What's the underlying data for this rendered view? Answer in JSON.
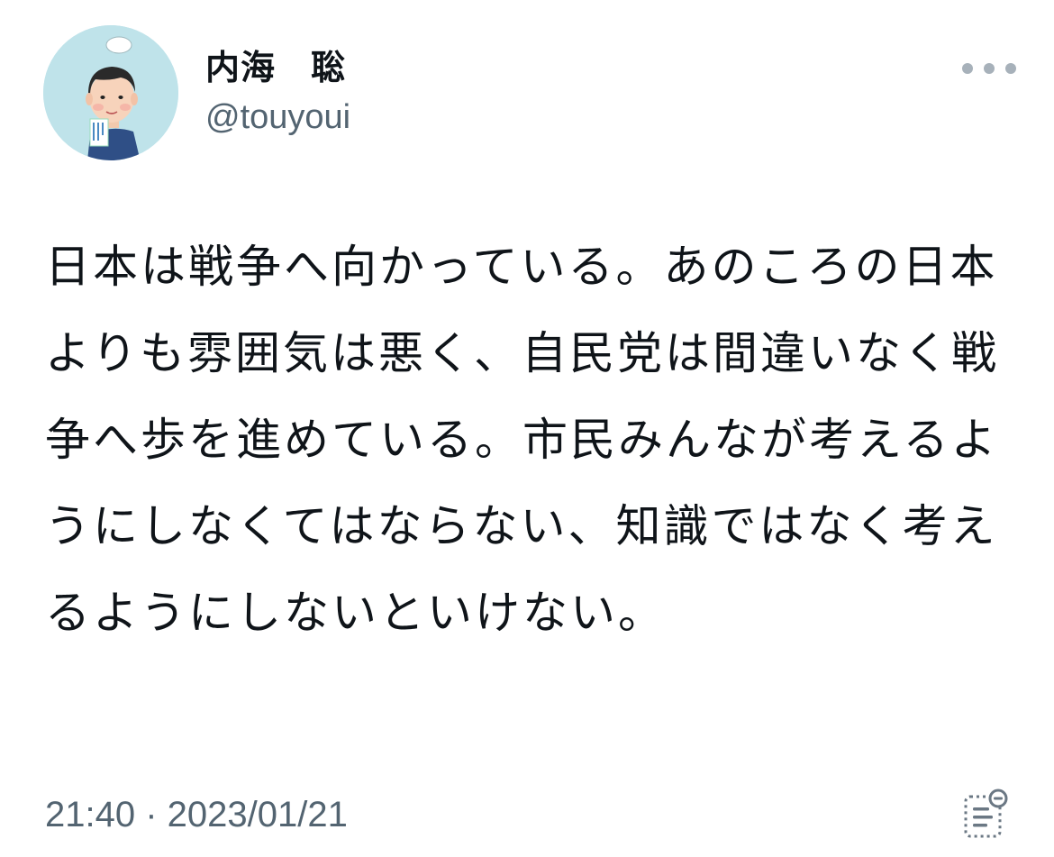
{
  "tweet": {
    "author": {
      "display_name": "内海　聡",
      "handle": "@touyoui",
      "avatar_icon": "user-avatar-illustration"
    },
    "text": "日本は戦争へ向かっている。あのころの日本よりも雰囲気は悪く、自民党は間違いなく戦争へ歩を進めている。市民みんなが考えるようにしなくてはならない、知識ではなく考えるようにしないといけない。",
    "timestamp": "21:40 · 2023/01/21",
    "more_icon": "more-options-icon",
    "analytics_icon": "analytics-icon"
  },
  "colors": {
    "text": "#0f1419",
    "secondary": "#536471",
    "avatar_bg": "#bfe3ea",
    "icon_gray": "#a7b1ba"
  }
}
